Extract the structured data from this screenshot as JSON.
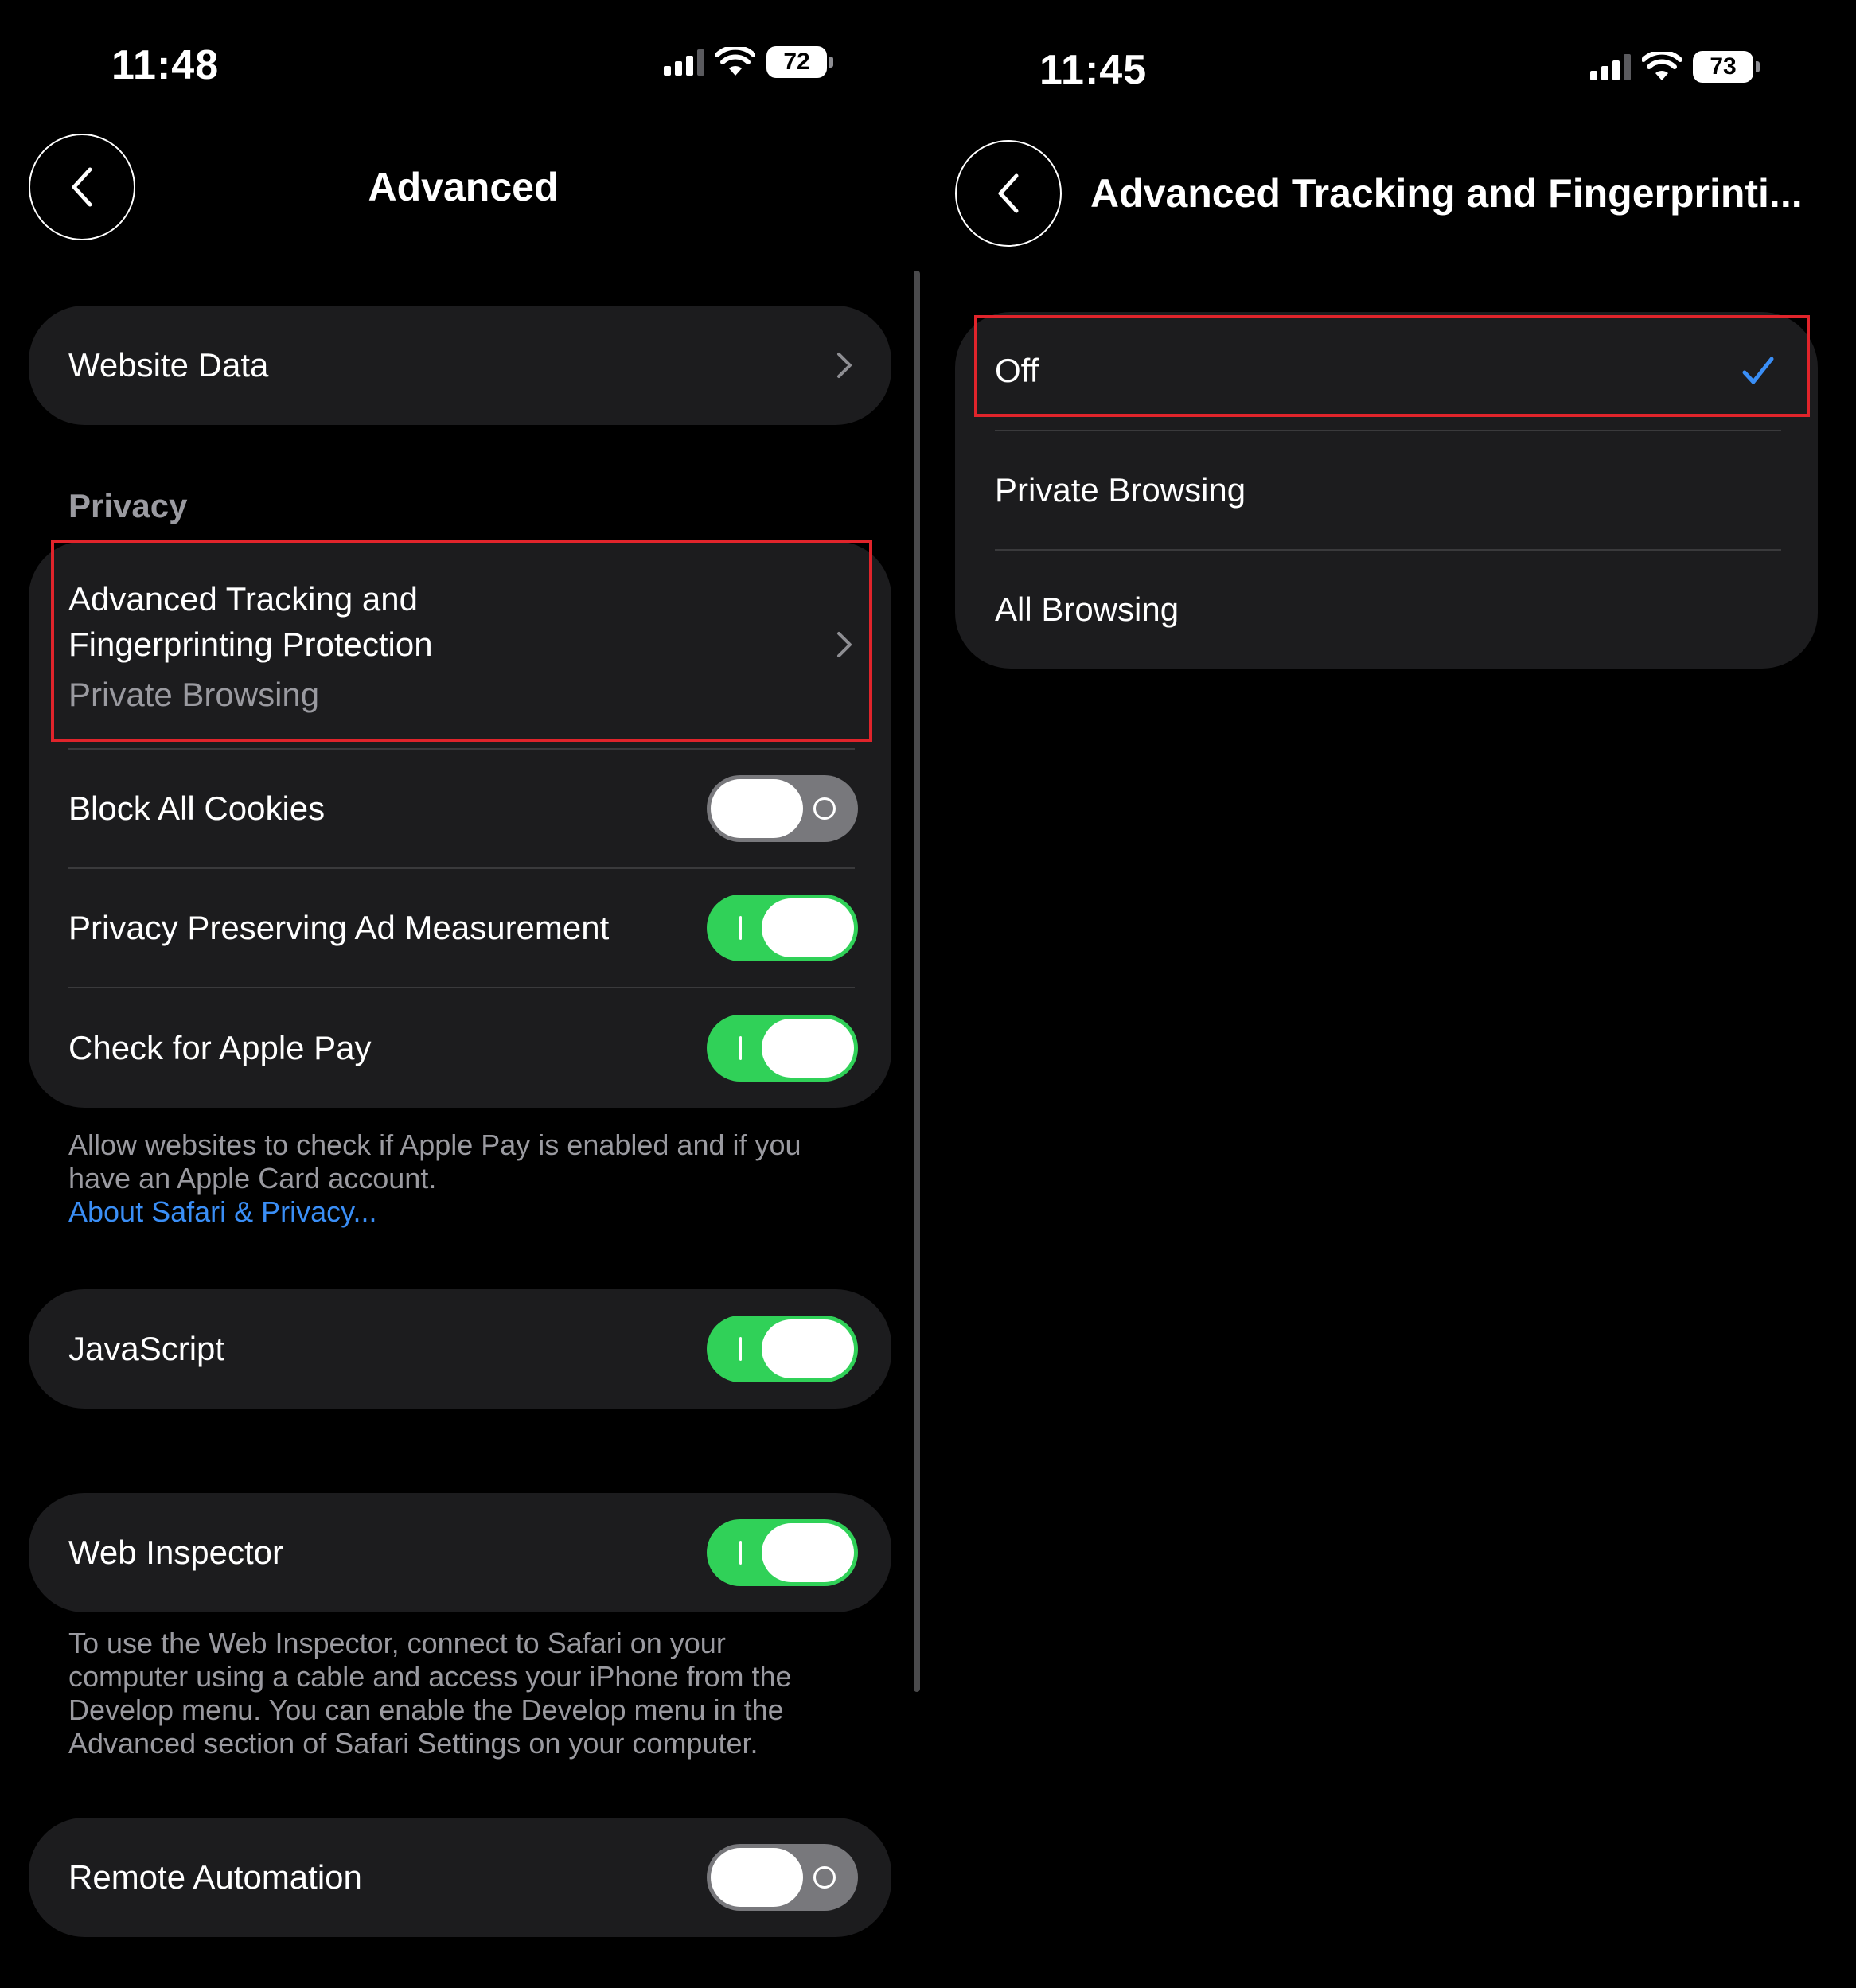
{
  "left": {
    "status": {
      "time": "11:48",
      "battery": "72"
    },
    "nav": {
      "title": "Advanced"
    },
    "website_data": {
      "label": "Website Data"
    },
    "privacy_header": "Privacy",
    "privacy_group": {
      "tracking_title_line1": "Advanced Tracking and",
      "tracking_title_line2": "Fingerprinting Protection",
      "tracking_value": "Private Browsing",
      "block_cookies": {
        "label": "Block All Cookies",
        "state": "off"
      },
      "ad_measurement": {
        "label": "Privacy Preserving Ad Measurement",
        "state": "on"
      },
      "apple_pay": {
        "label": "Check for Apple Pay",
        "state": "on"
      }
    },
    "apple_pay_footer": {
      "line1": "Allow websites to check if Apple Pay is enabled and if you",
      "line2": "have an Apple Card account.",
      "link": "About Safari & Privacy..."
    },
    "javascript": {
      "label": "JavaScript",
      "state": "on"
    },
    "web_inspector": {
      "label": "Web Inspector",
      "state": "on"
    },
    "web_inspector_footer": {
      "line1": "To use the Web Inspector, connect to Safari on your",
      "line2": "computer using a cable and access your iPhone from the",
      "line3": "Develop menu. You can enable the Develop menu in the",
      "line4": "Advanced section of Safari Settings on your computer."
    },
    "remote_automation": {
      "label": "Remote Automation",
      "state": "off"
    }
  },
  "right": {
    "status": {
      "time": "11:45",
      "battery": "73"
    },
    "nav": {
      "title": "Advanced Tracking and Fingerprinti..."
    },
    "options": [
      {
        "label": "Off",
        "selected": true
      },
      {
        "label": "Private Browsing",
        "selected": false
      },
      {
        "label": "All Browsing",
        "selected": false
      }
    ]
  },
  "colors": {
    "toggle_on": "#30d158",
    "toggle_off": "#78787c",
    "link": "#3a8ef6",
    "checkmark": "#3a8ef6",
    "highlight": "#e0242b",
    "group_bg": "#1c1c1e"
  },
  "icons": [
    "chevron-left-icon",
    "chevron-right-icon",
    "checkmark-icon",
    "signal-icon",
    "wifi-icon",
    "battery-icon"
  ]
}
